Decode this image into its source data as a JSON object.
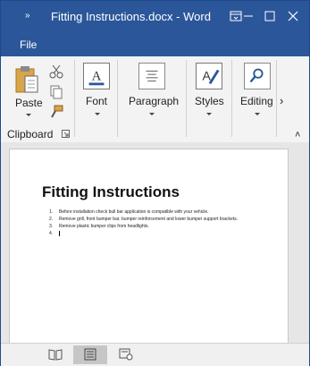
{
  "window": {
    "title": "Fitting Instructions.docx  -  Word",
    "qat_glyph": "»"
  },
  "menu": {
    "file_label": "File"
  },
  "ribbon": {
    "clipboard": {
      "paste_label": "Paste",
      "group_label": "Clipboard"
    },
    "font_label": "Font",
    "paragraph_label": "Paragraph",
    "styles_label": "Styles",
    "editing_label": "Editing",
    "scroll_right_glyph": "›",
    "collapse_glyph": "˄"
  },
  "document": {
    "title": "Fitting Instructions",
    "steps": [
      {
        "num": "1.",
        "text": "Before installation check bull bar application is compatible with your vehicle."
      },
      {
        "num": "2.",
        "text": "Remove grill, front bumper bar, bumper reinforcement and lower bumper support brackets."
      },
      {
        "num": "3.",
        "text": "Remove plastic bumper clips from headlights."
      },
      {
        "num": "4.",
        "text": ""
      }
    ]
  },
  "colors": {
    "accent": "#2b579a",
    "ribbon": "#f3f3f3"
  }
}
